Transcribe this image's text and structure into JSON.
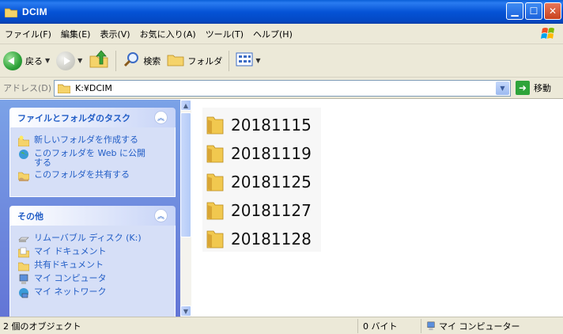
{
  "window": {
    "title": "DCIM"
  },
  "menu": [
    "ファイル(F)",
    "編集(E)",
    "表示(V)",
    "お気に入り(A)",
    "ツール(T)",
    "ヘルプ(H)"
  ],
  "toolbar": {
    "back_label": "戻る",
    "search_label": "検索",
    "folders_label": "フォルダ"
  },
  "address": {
    "label": "アドレス(D)",
    "value": "K:¥DCIM",
    "go_label": "移動"
  },
  "tasks_panel": {
    "title": "ファイルとフォルダのタスク",
    "items": [
      "新しいフォルダを作成する",
      "このフォルダを Web に公開\nする",
      "このフォルダを共有する"
    ]
  },
  "other_panel": {
    "title": "その他",
    "items": [
      "リムーバブル ディスク (K:)",
      "マイ ドキュメント",
      "共有ドキュメント",
      "マイ コンピュータ",
      "マイ ネットワーク"
    ]
  },
  "folders": [
    "20181115",
    "20181119",
    "20181125",
    "20181127",
    "20181128"
  ],
  "status": {
    "objects": "2 個のオブジェクト",
    "size": "0 バイト",
    "location": "マイ コンピューター"
  }
}
